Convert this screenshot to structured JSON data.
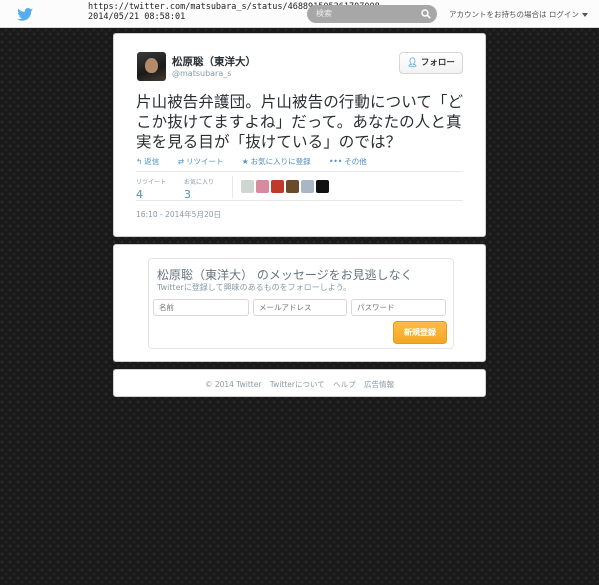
{
  "header": {
    "url": "https://twitter.com/matsubara_s/status/468891505361707008",
    "capture_time": "2014/05/21  08:58:01",
    "search_placeholder": "検索",
    "login_prompt": "アカウントをお持ちの場合は ログイン"
  },
  "tweet": {
    "author_name": "松原聡（東洋大）",
    "author_handle": "@matsubara_s",
    "follow_label": "フォロー",
    "text": "片山被告弁護団。片山被告の行動について「どこか抜けてますよね」だって。あなたの人と真実を見る目が「抜けている」のでは？",
    "actions": {
      "reply": "返信",
      "retweet": "リツイート",
      "favorite": "お気に入りに登録",
      "more": "その他"
    },
    "stats": {
      "retweets_label": "リツイート",
      "retweets": "4",
      "favorites_label": "お気に入り",
      "favorites": "3"
    },
    "favoriters": [
      "#cfd8d0",
      "#d88aa0",
      "#c0392b",
      "#6b4a2a",
      "#a9b6c4",
      "#111111"
    ],
    "timestamp": "16:10 - 2014年5月20日"
  },
  "signup": {
    "title": "松原聡（東洋大） のメッセージをお見逃しなく",
    "subtitle": "Twitterに登録して興味のあるものをフォローしよう。",
    "name_placeholder": "名前",
    "email_placeholder": "メールアドレス",
    "password_placeholder": "パスワード",
    "button_label": "新規登録"
  },
  "footer": {
    "copyright": "© 2014 Twitter",
    "about": "Twitterについて",
    "help": "ヘルプ",
    "ads": "広告情報"
  },
  "colors": {
    "accent": "#55acee",
    "signup_button": "#f5a623"
  }
}
